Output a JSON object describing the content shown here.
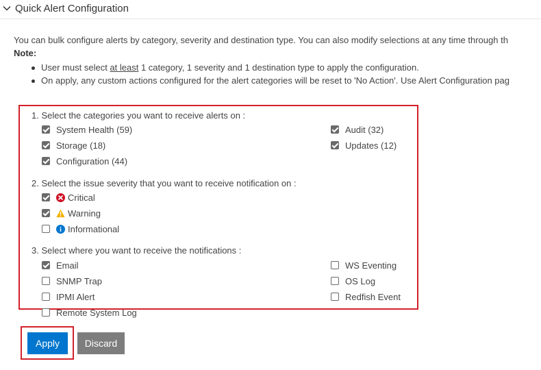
{
  "header": {
    "title": "Quick Alert Configuration"
  },
  "intro": "You can bulk configure alerts by category, severity and destination type. You can also modify selections at any time through th",
  "note_label": "Note:",
  "bullets": [
    {
      "before": "User must select ",
      "underlined": "at least",
      "after": " 1 category, 1 severity and 1 destination type to apply the configuration."
    },
    {
      "text": "On apply, any custom actions configured for the alert categories will be reset to 'No Action'. Use Alert Configuration pag"
    }
  ],
  "categories": {
    "heading": "1. Select the categories you want to receive alerts on :",
    "items": [
      {
        "label": "System Health (59)",
        "checked": true
      },
      {
        "label": "Storage (18)",
        "checked": true
      },
      {
        "label": "Configuration (44)",
        "checked": true
      },
      {
        "label": "Audit (32)",
        "checked": true
      },
      {
        "label": "Updates (12)",
        "checked": true
      }
    ]
  },
  "severity": {
    "heading": "2. Select the issue severity that you want to receive notification on :",
    "items": [
      {
        "label": "Critical",
        "checked": true,
        "icon": "critical-icon",
        "color": "#ce1126"
      },
      {
        "label": "Warning",
        "checked": true,
        "icon": "warning-icon",
        "color": "#f2af00"
      },
      {
        "label": "Informational",
        "checked": false,
        "icon": "info-icon",
        "color": "#0076ce"
      }
    ]
  },
  "destinations": {
    "heading": "3. Select where you want to receive the notifications :",
    "items": [
      {
        "label": "Email",
        "checked": true
      },
      {
        "label": "SNMP Trap",
        "checked": false
      },
      {
        "label": "IPMI Alert",
        "checked": false
      },
      {
        "label": "Remote System Log",
        "checked": false
      },
      {
        "label": "WS Eventing",
        "checked": false
      },
      {
        "label": "OS Log",
        "checked": false
      },
      {
        "label": "Redfish Event",
        "checked": false
      }
    ]
  },
  "buttons": {
    "apply": "Apply",
    "discard": "Discard"
  },
  "colors": {
    "accent": "#0076ce",
    "highlight": "#d32029",
    "discard": "#7d7d7d"
  }
}
